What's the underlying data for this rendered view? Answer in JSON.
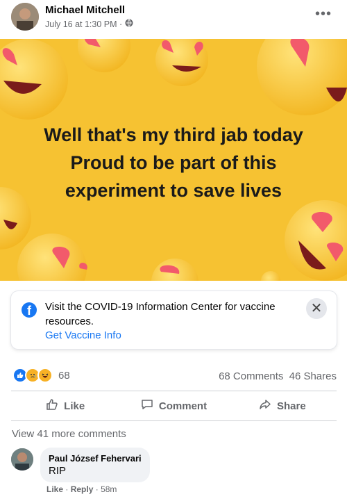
{
  "post": {
    "author": "Michael Mitchell",
    "timestamp": "July 16 at 1:30 PM ·",
    "privacy_icon": "globe-icon",
    "more_label": "•••",
    "banner_lines": [
      "Well that's my third jab today",
      "Proud to be part of this",
      "experiment to save lives"
    ],
    "banner_color": "#f6c232"
  },
  "info_card": {
    "text": "Visit the COVID-19 Information Center for vaccine resources.",
    "link": "Get Vaccine Info",
    "close": "✕"
  },
  "stats": {
    "reaction_count": "68",
    "comments": "68 Comments",
    "shares": "46 Shares"
  },
  "actions": {
    "like": "Like",
    "comment": "Comment",
    "share": "Share"
  },
  "comments": {
    "view_more": "View 41 more comments",
    "items": [
      {
        "name": "Paul József Fehervari",
        "text": "RIP",
        "like": "Like",
        "reply": "Reply",
        "time": "58m"
      }
    ]
  }
}
